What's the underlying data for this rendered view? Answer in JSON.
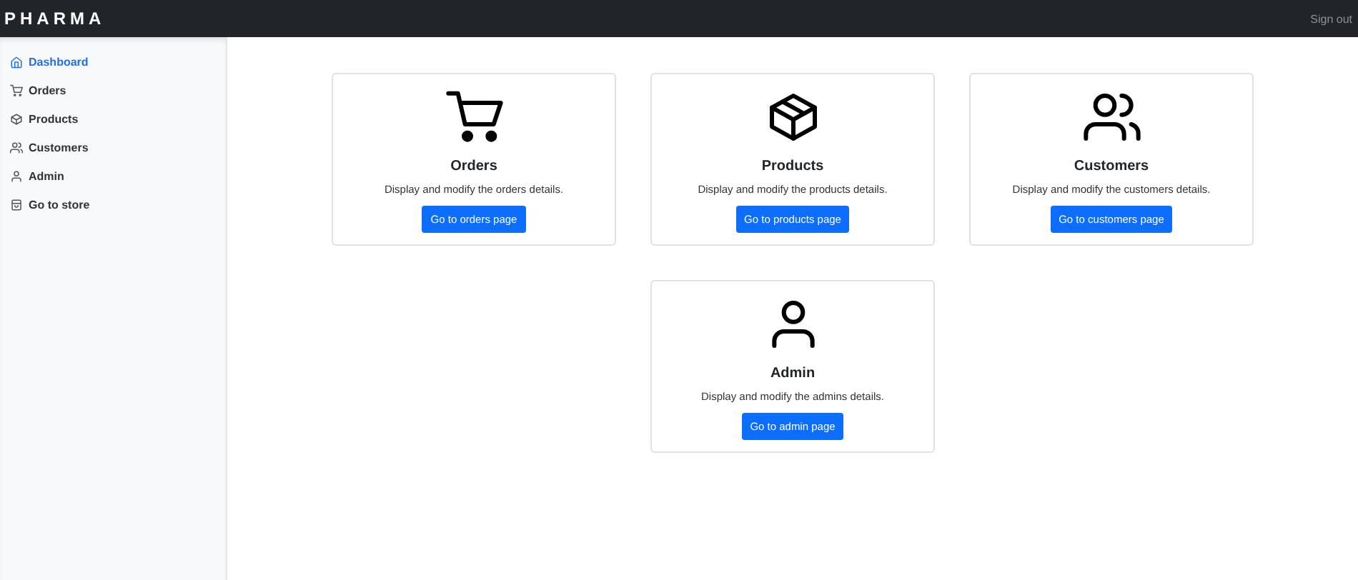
{
  "header": {
    "brand": "PHARMA",
    "sign_out": "Sign out"
  },
  "sidebar": {
    "items": [
      {
        "label": "Dashboard",
        "kind": "home",
        "selected": true
      },
      {
        "label": "Orders",
        "kind": "cart",
        "selected": false
      },
      {
        "label": "Products",
        "kind": "box",
        "selected": false
      },
      {
        "label": "Customers",
        "kind": "people",
        "selected": false
      },
      {
        "label": "Admin",
        "kind": "person",
        "selected": false
      },
      {
        "label": "Go to store",
        "kind": "store",
        "selected": false
      }
    ]
  },
  "cards": [
    {
      "kind": "cart",
      "title": "Orders",
      "text": "Display and modify the orders details.",
      "button": "Go to orders page"
    },
    {
      "kind": "box",
      "title": "Products",
      "text": "Display and modify the products details.",
      "button": "Go to products page"
    },
    {
      "kind": "people",
      "title": "Customers",
      "text": "Display and modify the customers details.",
      "button": "Go to customers page"
    },
    {
      "kind": "person",
      "title": "Admin",
      "text": "Display and modify the admins details.",
      "button": "Go to admin page"
    }
  ]
}
